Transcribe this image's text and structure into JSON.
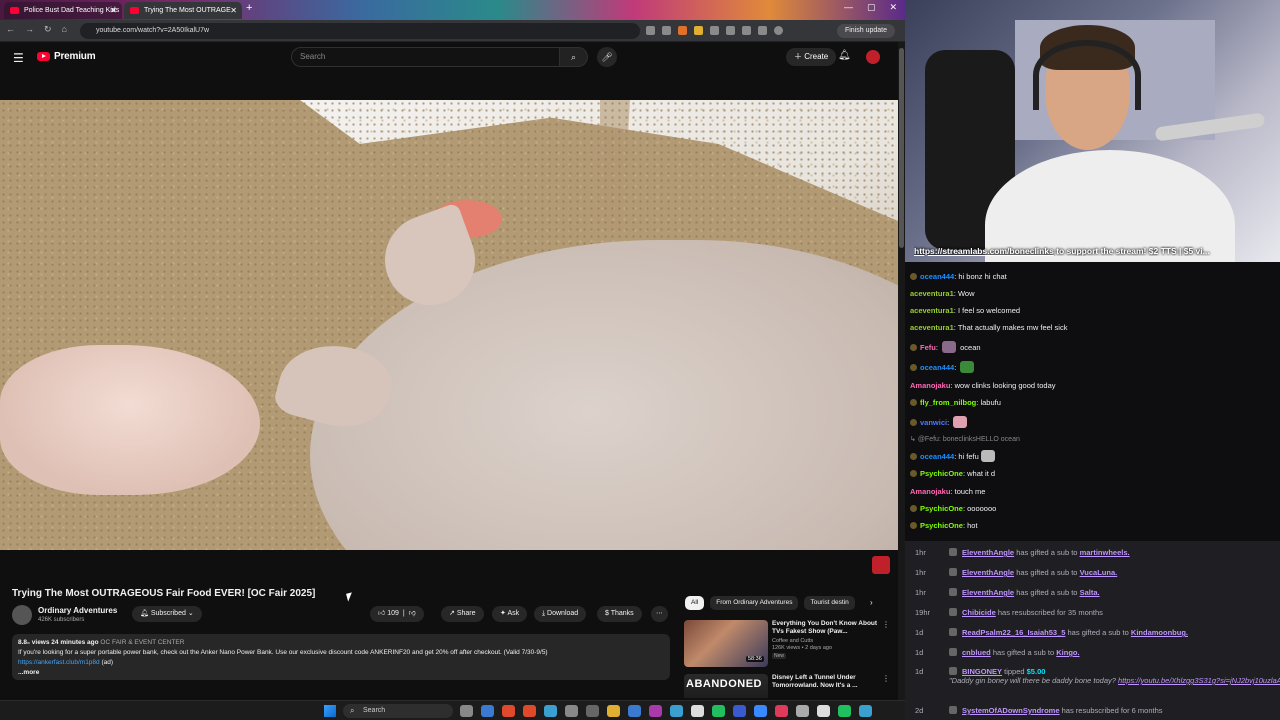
{
  "browser": {
    "tabs": [
      {
        "label": "Police Bust Dad Teaching Kids",
        "active": false
      },
      {
        "label": "Trying The Most OUTRAGE",
        "active": true
      }
    ],
    "url": "youtube.com/watch?v=2A50IkalU7w",
    "finish_update_label": "Finish update",
    "window_controls": [
      "—",
      "▢",
      "✕"
    ]
  },
  "youtube": {
    "logo_text": "Premium",
    "search_placeholder": "Search",
    "create_label": "Create"
  },
  "video": {
    "title": "Trying The Most OUTRAGEOUS Fair Food EVER! [OC Fair 2025]",
    "channel": "Ordinary Adventures",
    "subscribers": "426K subscribers",
    "subscribed_label": "Subscribed",
    "likes": "109",
    "share_label": "Share",
    "ask_label": "Ask",
    "download_label": "Download",
    "thanks_label": "Thanks",
    "views_time": "8.8₀ views  24 minutes ago",
    "category": "OC FAIR & EVENT CENTER",
    "description": "If you're looking for a super portable power bank, check out the Anker Nano Power Bank. Use our exclusive discount code ANKERINF20 and get 20% off after checkout. (Valid 7/30-9/5)",
    "desc_link": "https://ankerfast.club/m1p8d",
    "desc_link_suffix": "(ad)",
    "more_label": "...more"
  },
  "related": {
    "chips": [
      "All",
      "From Ordinary Adventures",
      "Tourist destin"
    ],
    "items": [
      {
        "title": "Everything You Don't Know About TVs Fakest Show (Paw...",
        "channel": "Coffee and Cutts",
        "views": "126K views • 2 days ago",
        "badge": "New",
        "duration": "58:36"
      },
      {
        "title": "Disney Left a Tunnel Under Tomorrowland. Now It's a ...",
        "thumb_text": "ABANDONED"
      }
    ]
  },
  "stream": {
    "ticker_link": "https://streamlabs.com/boneclinks",
    "ticker_text": " to support the stream! $2 TTS | $5 vi..."
  },
  "chat": [
    {
      "user": "ocean444",
      "color": "#1e90ff",
      "text": "hi bonz hi chat",
      "badge": true
    },
    {
      "user": "aceventura1",
      "color": "#9acd32",
      "text": "Wow",
      "badge": false
    },
    {
      "user": "aceventura1",
      "color": "#9acd32",
      "text": "I feel so welcomed",
      "badge": false
    },
    {
      "user": "aceventura1",
      "color": "#9acd32",
      "text": "That actually makes mw feel sick",
      "badge": false
    },
    {
      "user": "Fefu",
      "color": "#ff69b4",
      "text": "ocean",
      "badge": true,
      "emote": "#8a6a8a"
    },
    {
      "user": "ocean444",
      "color": "#1e90ff",
      "text": "",
      "badge": true,
      "emote": "#3a8a3a"
    },
    {
      "user": "Amanojaku",
      "color": "#ff69b4",
      "text": "wow clinks looking good today",
      "badge": false
    },
    {
      "user": "fly_from_nilbog",
      "color": "#7fff00",
      "text": "labufu",
      "badge": true
    },
    {
      "user": "vanwici",
      "color": "#4a7aff",
      "text": "",
      "badge": true,
      "emote": "#e0a0b0"
    },
    {
      "reply": "@Fefu: boneclinksHELLO ocean"
    },
    {
      "user": "ocean444",
      "color": "#1e90ff",
      "text": "hi fefu",
      "badge": true,
      "emote": "#bbbbbb"
    },
    {
      "user": "PsychicOne",
      "color": "#7fff00",
      "text": "what it d",
      "badge": true
    },
    {
      "user": "Amanojaku",
      "color": "#ff69b4",
      "text": "touch me",
      "badge": false
    },
    {
      "user": "PsychicOne",
      "color": "#7fff00",
      "text": "ooooooo",
      "badge": true
    },
    {
      "user": "PsychicOne",
      "color": "#7fff00",
      "text": "hot",
      "badge": true
    }
  ],
  "events": [
    {
      "time": "1hr",
      "user": "EleventhAngle",
      "text": "has gifted a sub to",
      "target": "martinwheels."
    },
    {
      "time": "1hr",
      "user": "EleventhAngle",
      "text": "has gifted a sub to",
      "target": "VucaLuna."
    },
    {
      "time": "1hr",
      "user": "EleventhAngle",
      "text": "has gifted a sub to",
      "target": "Salta."
    },
    {
      "time": "19hr",
      "user": "Chibicide",
      "text": "has resubscribed for 35 months",
      "target": ""
    },
    {
      "time": "1d",
      "user": "ReadPsalm22_16_Isaiah53_5",
      "text": "has gifted a sub to",
      "target": "Kindamoonbug."
    },
    {
      "time": "1d",
      "user": "cnblued",
      "text": "has gifted a sub to",
      "target": "Kingo."
    },
    {
      "time": "1d",
      "user": "BINGONEY",
      "text": "tipped",
      "tip": "$5.00",
      "quote": "\"Daddy gin boney will there be daddy bone today? ",
      "quote_link": "https://youtu.be/Xhlzgg3S31g?si=jNJ2bvj10uzlaA",
      "quote_end": "\""
    },
    {
      "time": "2d",
      "user": "SystemOfADownSyndrome",
      "text": "has resubscribed for 6 months",
      "target": ""
    }
  ],
  "taskbar": {
    "search_label": "Search",
    "icon_colors": [
      "#888",
      "#3a7ad0",
      "#e04a2a",
      "#e04a2a",
      "#3aa0d0",
      "#888",
      "#666",
      "#e0b030",
      "#3a7ad0",
      "#aa3aaa",
      "#3aa0d0",
      "#ddd",
      "#20c060",
      "#3a5ad0",
      "#3a8aff",
      "#e03a5a",
      "#aaa",
      "#ddd",
      "#20c060",
      "#3aa0d0"
    ]
  }
}
